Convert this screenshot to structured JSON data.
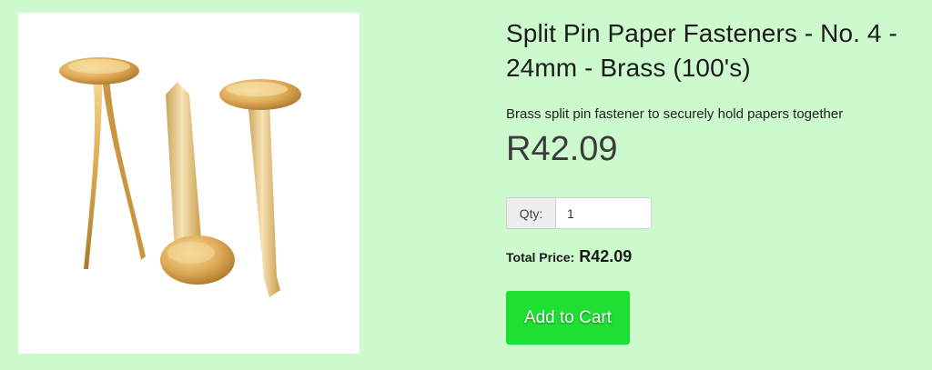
{
  "product": {
    "image_alt": "Brass split pin paper fasteners",
    "title": "Split Pin Paper Fasteners - No. 4 - 24mm - Brass (100's)",
    "description": "Brass split pin fastener to securely hold papers together",
    "price": "R42.09"
  },
  "quantity": {
    "label": "Qty:",
    "value": "1"
  },
  "total": {
    "label": "Total Price:",
    "value": "R42.09"
  },
  "cart": {
    "button_label": "Add to Cart"
  },
  "colors": {
    "background": "#ccfacd",
    "button": "#1ee033",
    "brass": "#d9a950"
  }
}
